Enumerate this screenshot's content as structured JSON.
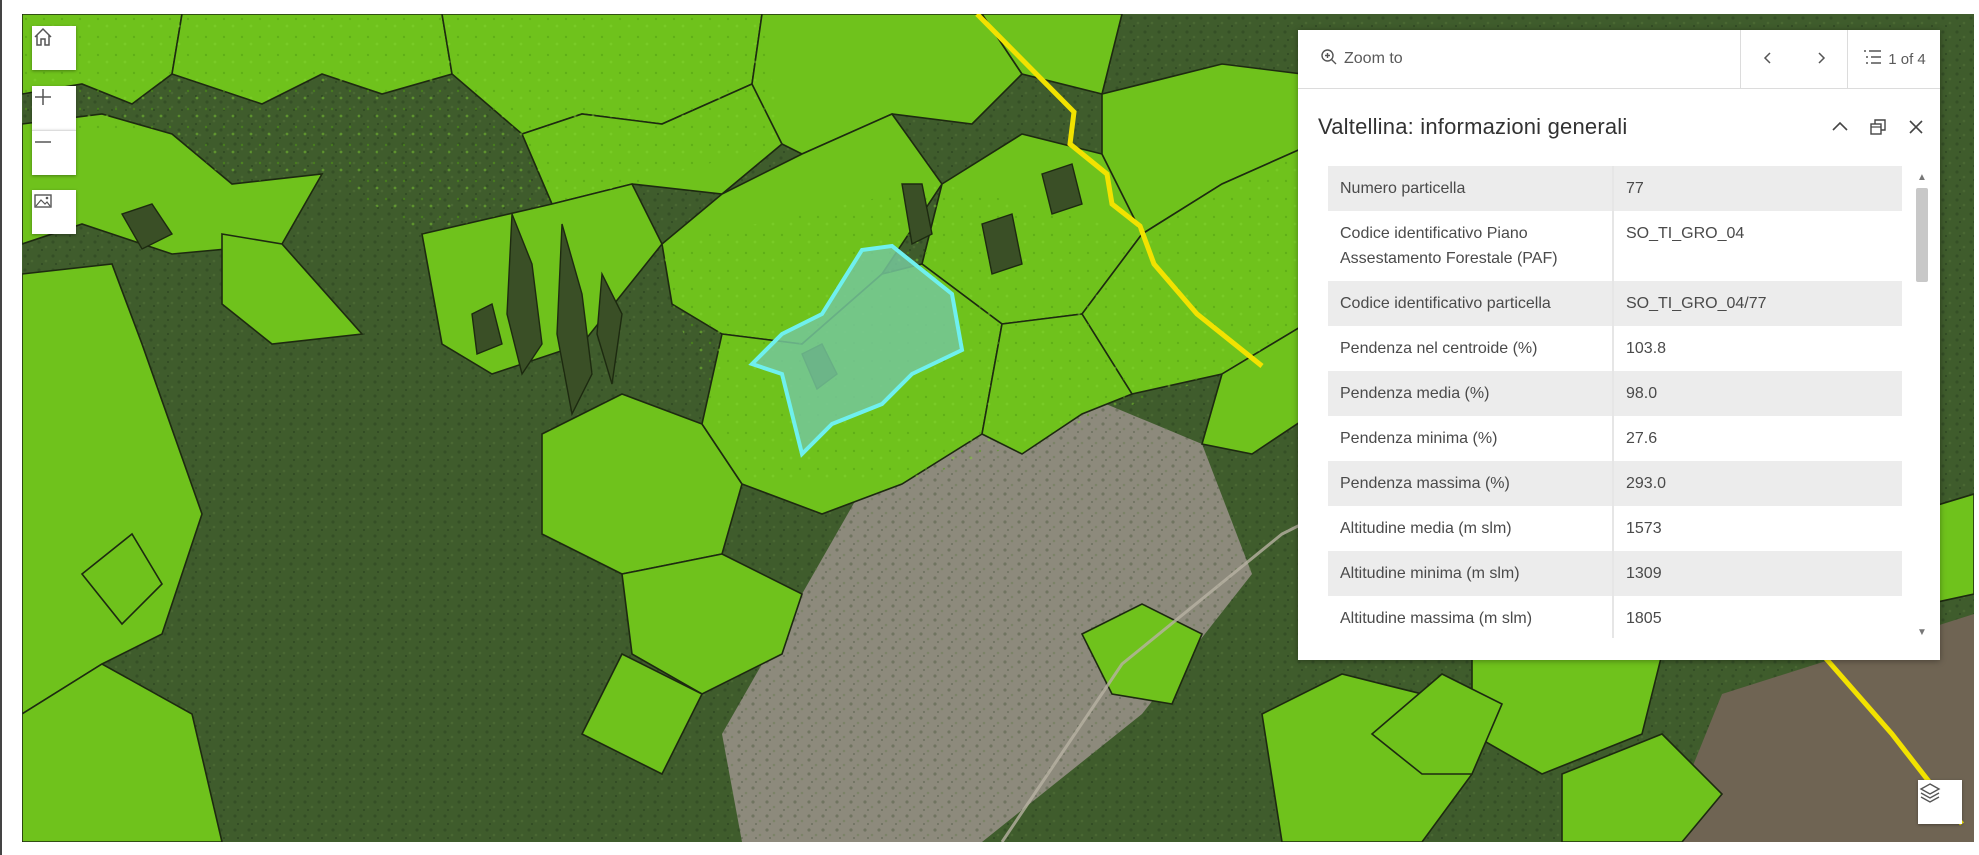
{
  "map": {
    "home_icon": "home-icon",
    "zoom_in_icon": "plus-icon",
    "zoom_out_icon": "minus-icon",
    "basemap_icon": "image-icon",
    "layers_icon": "layers-icon",
    "colors": {
      "forest_parcel": "#6fc21c",
      "selected_parcel": "#76c79a",
      "selected_outline": "#6ff0ee",
      "boundary_line": "#f2e200"
    }
  },
  "popup": {
    "zoom_to_label": "Zoom to",
    "prev_icon": "chevron-left-icon",
    "next_icon": "chevron-right-icon",
    "feature_count": "1 of 4",
    "title": "Valtellina: informazioni generali",
    "collapse_icon": "chevron-up-icon",
    "dock_icon": "dock-icon",
    "close_icon": "close-icon",
    "attributes": [
      {
        "label": "Numero particella",
        "value": "77"
      },
      {
        "label": "Codice identificativo Piano Assestamento Forestale (PAF)",
        "value": "SO_TI_GRO_04"
      },
      {
        "label": "Codice identificativo particella",
        "value": "SO_TI_GRO_04/77"
      },
      {
        "label": "Pendenza nel centroide (%)",
        "value": "103.8"
      },
      {
        "label": "Pendenza media (%)",
        "value": "98.0"
      },
      {
        "label": "Pendenza minima (%)",
        "value": "27.6"
      },
      {
        "label": "Pendenza massima (%)",
        "value": "293.0"
      },
      {
        "label": "Altitudine media (m slm)",
        "value": "1573"
      },
      {
        "label": "Altitudine minima (m slm)",
        "value": "1309"
      },
      {
        "label": "Altitudine massima (m slm)",
        "value": "1805"
      }
    ]
  }
}
